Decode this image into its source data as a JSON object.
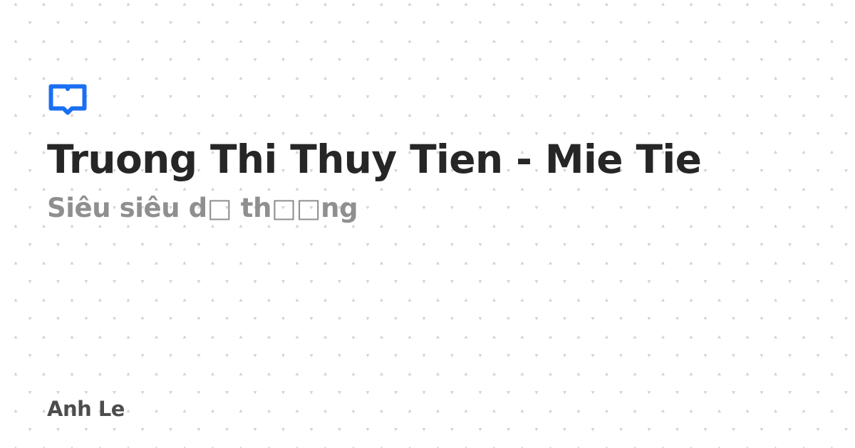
{
  "title": "Truong Thi Thuy Tien - Mie Tie",
  "subtitle": "Siêu siêu d□ th□□ng",
  "author": "Anh Le",
  "icon": "open-book-icon",
  "colors": {
    "background": "#ffffff",
    "accent": "#1a6ff2",
    "title": "#262626",
    "subtitle": "#8f8f8f",
    "author": "#4d4d4d",
    "pattern": "#d4d4d4"
  }
}
